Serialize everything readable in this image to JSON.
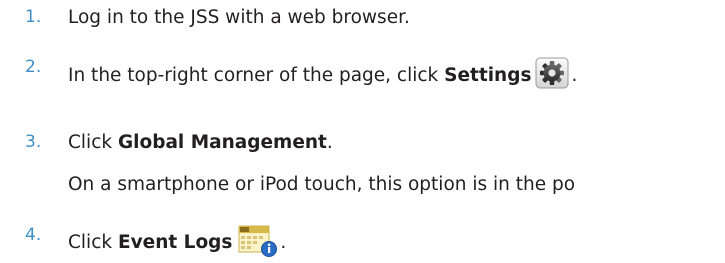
{
  "steps": [
    {
      "number": "1.",
      "text": "Log in to the JSS with a web browser."
    },
    {
      "number": "2.",
      "text_before": "In the top-right corner of the page, click ",
      "bold": "Settings",
      "icon": "gear-icon",
      "text_after": "."
    },
    {
      "number": "3.",
      "text_before": "Click ",
      "bold": "Global Management",
      "text_after": ".",
      "note": "On a smartphone or iPod touch, this option is in the po"
    },
    {
      "number": "4.",
      "text_before": "Click ",
      "bold": "Event Logs",
      "icon": "calendar-info-icon",
      "text_after": "."
    }
  ],
  "colors": {
    "step_number": "#3e8fc7",
    "body_text": "#231f20"
  }
}
